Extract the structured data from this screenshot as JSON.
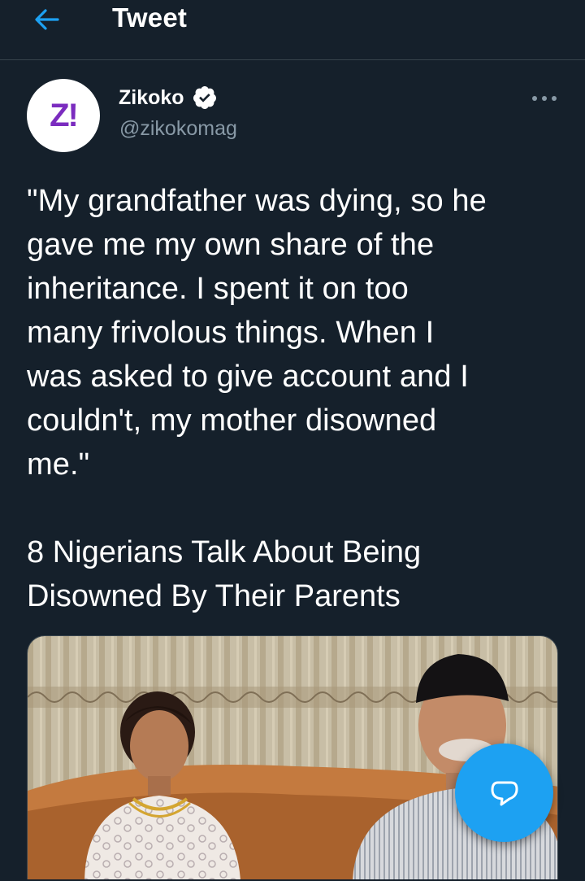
{
  "header": {
    "back_icon": "arrow-left-icon",
    "title": "Tweet"
  },
  "tweet": {
    "author": {
      "avatar_text": "Z!",
      "name": "Zikoko",
      "verified": true,
      "handle": "@zikokomag"
    },
    "more_icon": "more-dots-icon",
    "text_lines": [
      "\"My grandfather was dying, so he",
      "gave me my own share of the",
      "inheritance. I spent it on too",
      "many frivolous things. When I",
      "was asked to give account and I",
      "couldn't, my mother disowned",
      "me.\""
    ],
    "link_title_lines": [
      "8 Nigerians Talk About Being",
      "Disowned By Their Parents"
    ]
  },
  "fab": {
    "icon": "reply-bubble-icon"
  },
  "colors": {
    "background": "#15202b",
    "accent": "#1da1f2",
    "secondary_text": "#8899a6",
    "divider": "#38444d",
    "avatar_brand": "#7b2cbf"
  }
}
